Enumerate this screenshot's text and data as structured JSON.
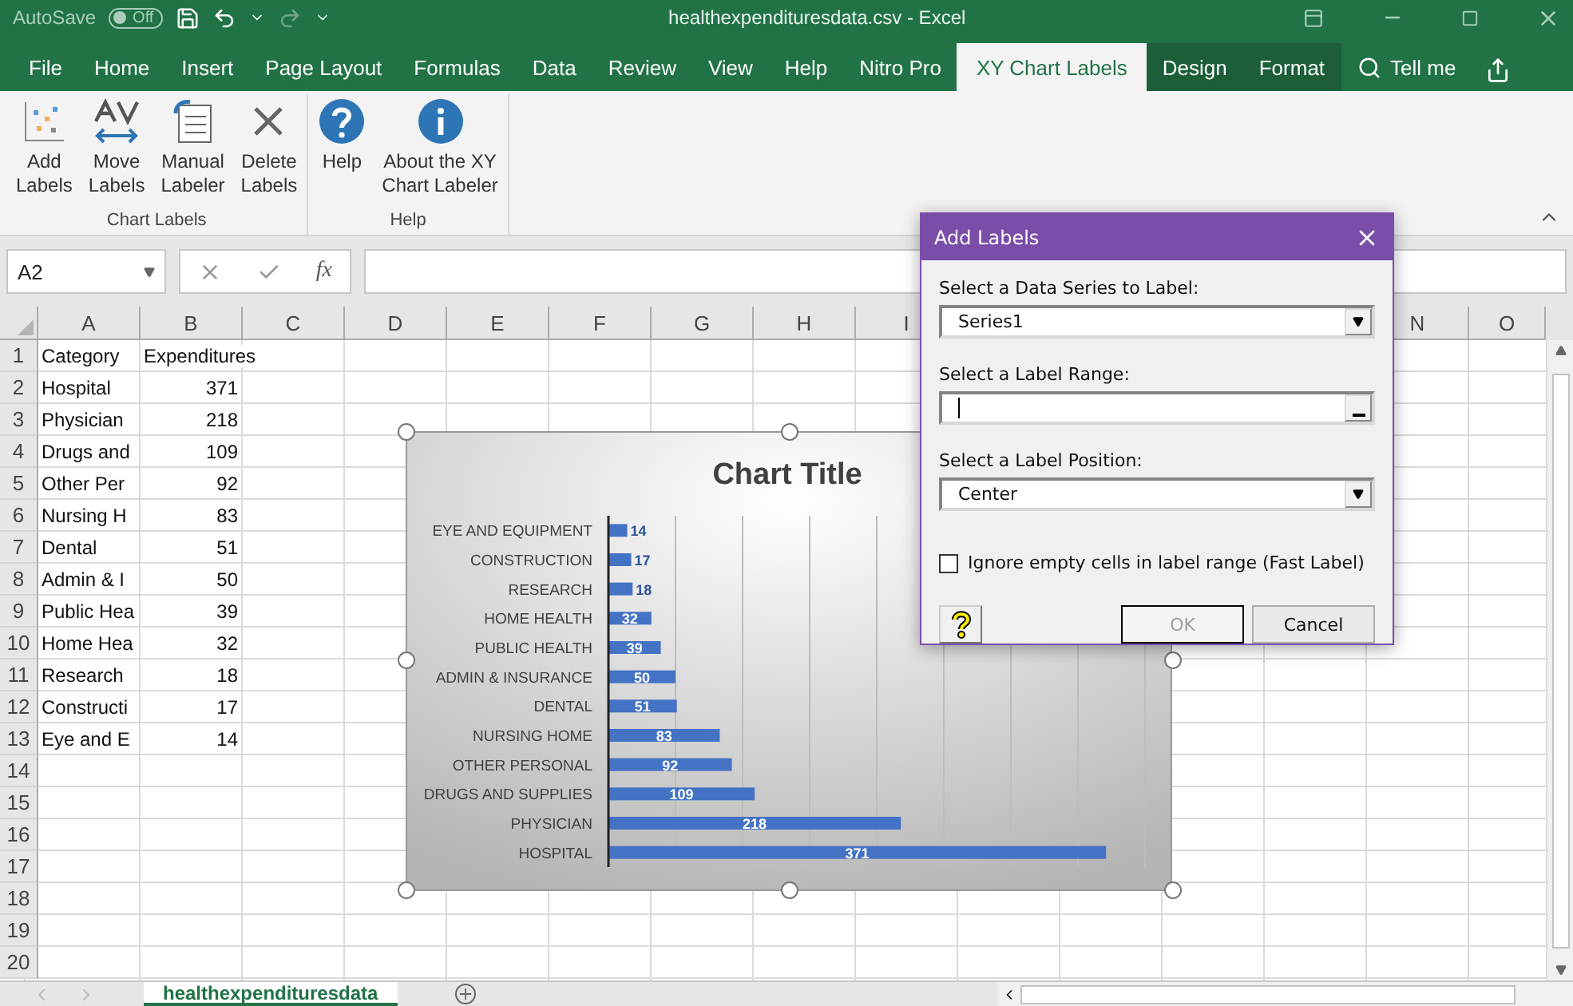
{
  "title_bar": {
    "autosave": {
      "label": "AutoSave",
      "state": "Off",
      "on": false
    },
    "title": "healthexpendituresdata.csv  -  Excel"
  },
  "ribbon_tabs": [
    {
      "label": "File",
      "selected": false,
      "kind": "normal"
    },
    {
      "label": "Home",
      "selected": false,
      "kind": "normal"
    },
    {
      "label": "Insert",
      "selected": false,
      "kind": "normal"
    },
    {
      "label": "Page Layout",
      "selected": false,
      "kind": "normal"
    },
    {
      "label": "Formulas",
      "selected": false,
      "kind": "normal"
    },
    {
      "label": "Data",
      "selected": false,
      "kind": "normal"
    },
    {
      "label": "Review",
      "selected": false,
      "kind": "normal"
    },
    {
      "label": "View",
      "selected": false,
      "kind": "normal"
    },
    {
      "label": "Help",
      "selected": false,
      "kind": "normal"
    },
    {
      "label": "Nitro Pro",
      "selected": false,
      "kind": "normal"
    },
    {
      "label": "XY Chart Labels",
      "selected": true,
      "kind": "normal"
    },
    {
      "label": "Design",
      "selected": false,
      "kind": "contextual"
    },
    {
      "label": "Format",
      "selected": false,
      "kind": "contextual"
    }
  ],
  "tell_me": "Tell me",
  "ribbon_groups": [
    {
      "name": "Chart Labels",
      "buttons": [
        {
          "lines": [
            "Add",
            "Labels"
          ]
        },
        {
          "lines": [
            "Move",
            "Labels"
          ]
        },
        {
          "lines": [
            "Manual",
            "Labeler"
          ]
        },
        {
          "lines": [
            "Delete",
            "Labels"
          ]
        }
      ]
    },
    {
      "name": "Help",
      "buttons": [
        {
          "lines": [
            "Help"
          ]
        },
        {
          "lines": [
            "About the XY",
            "Chart Labeler"
          ]
        }
      ]
    }
  ],
  "formula_bar": {
    "name_box": "A2",
    "function_label": "fx"
  },
  "sheet": {
    "columns": [
      "A",
      "B",
      "C",
      "D",
      "E",
      "F",
      "G",
      "H",
      "I",
      "N",
      "O"
    ],
    "rows": [
      {
        "number": "1",
        "cells": [
          {
            "text": "Category",
            "kind": "text"
          },
          {
            "text": "Expenditures",
            "kind": "text"
          }
        ]
      },
      {
        "number": "2",
        "cells": [
          {
            "text": "Hospital",
            "kind": "text"
          },
          {
            "text": "371",
            "kind": "number"
          }
        ]
      },
      {
        "number": "3",
        "cells": [
          {
            "text": "Physician",
            "kind": "text"
          },
          {
            "text": "218",
            "kind": "number"
          }
        ]
      },
      {
        "number": "4",
        "cells": [
          {
            "text": "Drugs and",
            "kind": "text"
          },
          {
            "text": "109",
            "kind": "number"
          }
        ]
      },
      {
        "number": "5",
        "cells": [
          {
            "text": "Other Per",
            "kind": "text"
          },
          {
            "text": "92",
            "kind": "number"
          }
        ]
      },
      {
        "number": "6",
        "cells": [
          {
            "text": "Nursing H",
            "kind": "text"
          },
          {
            "text": "83",
            "kind": "number"
          }
        ]
      },
      {
        "number": "7",
        "cells": [
          {
            "text": "Dental",
            "kind": "text"
          },
          {
            "text": "51",
            "kind": "number"
          }
        ]
      },
      {
        "number": "8",
        "cells": [
          {
            "text": "Admin & I",
            "kind": "text"
          },
          {
            "text": "50",
            "kind": "number"
          }
        ]
      },
      {
        "number": "9",
        "cells": [
          {
            "text": "Public Hea",
            "kind": "text"
          },
          {
            "text": "39",
            "kind": "number"
          }
        ]
      },
      {
        "number": "10",
        "cells": [
          {
            "text": "Home Hea",
            "kind": "text"
          },
          {
            "text": "32",
            "kind": "number"
          }
        ]
      },
      {
        "number": "11",
        "cells": [
          {
            "text": "Research",
            "kind": "text"
          },
          {
            "text": "18",
            "kind": "number"
          }
        ]
      },
      {
        "number": "12",
        "cells": [
          {
            "text": "Constructi",
            "kind": "text"
          },
          {
            "text": "17",
            "kind": "number"
          }
        ]
      },
      {
        "number": "13",
        "cells": [
          {
            "text": "Eye and E",
            "kind": "text"
          },
          {
            "text": "14",
            "kind": "number"
          }
        ]
      },
      {
        "number": "14",
        "cells": []
      },
      {
        "number": "15",
        "cells": []
      },
      {
        "number": "16",
        "cells": []
      },
      {
        "number": "17",
        "cells": []
      },
      {
        "number": "18",
        "cells": []
      },
      {
        "number": "19",
        "cells": []
      },
      {
        "number": "20",
        "cells": []
      }
    ]
  },
  "chart": {
    "chart_data": {
      "type": "bar",
      "orientation": "horizontal",
      "title": "Chart Title",
      "categories": [
        "EYE AND EQUIPMENT",
        "CONSTRUCTION",
        "RESEARCH",
        "HOME HEALTH",
        "PUBLIC HEALTH",
        "ADMIN & INSURANCE",
        "DENTAL",
        "NURSING HOME",
        "OTHER PERSONAL",
        "DRUGS AND SUPPLIES",
        "PHYSICIAN",
        "HOSPITAL"
      ],
      "values": [
        14,
        17,
        18,
        32,
        39,
        50,
        51,
        83,
        92,
        109,
        218,
        371
      ],
      "xlim": [
        0,
        400
      ],
      "data_labels": true
    }
  },
  "dialog": {
    "title": "Add Labels",
    "series_label": "Select a Data Series to Label:",
    "series_value": "Series1",
    "range_label": "Select a Label Range:",
    "position_label": "Select a Label Position:",
    "position_value": "Center",
    "ignore_empty": {
      "label": "Ignore empty cells in label range (Fast Label)",
      "checked": false
    },
    "ok": {
      "label": "OK",
      "disabled": true
    },
    "cancel": {
      "label": "Cancel",
      "disabled": false
    }
  },
  "sheet_tabs": [
    {
      "label": "healthexpendituresdata",
      "selected": true
    }
  ]
}
